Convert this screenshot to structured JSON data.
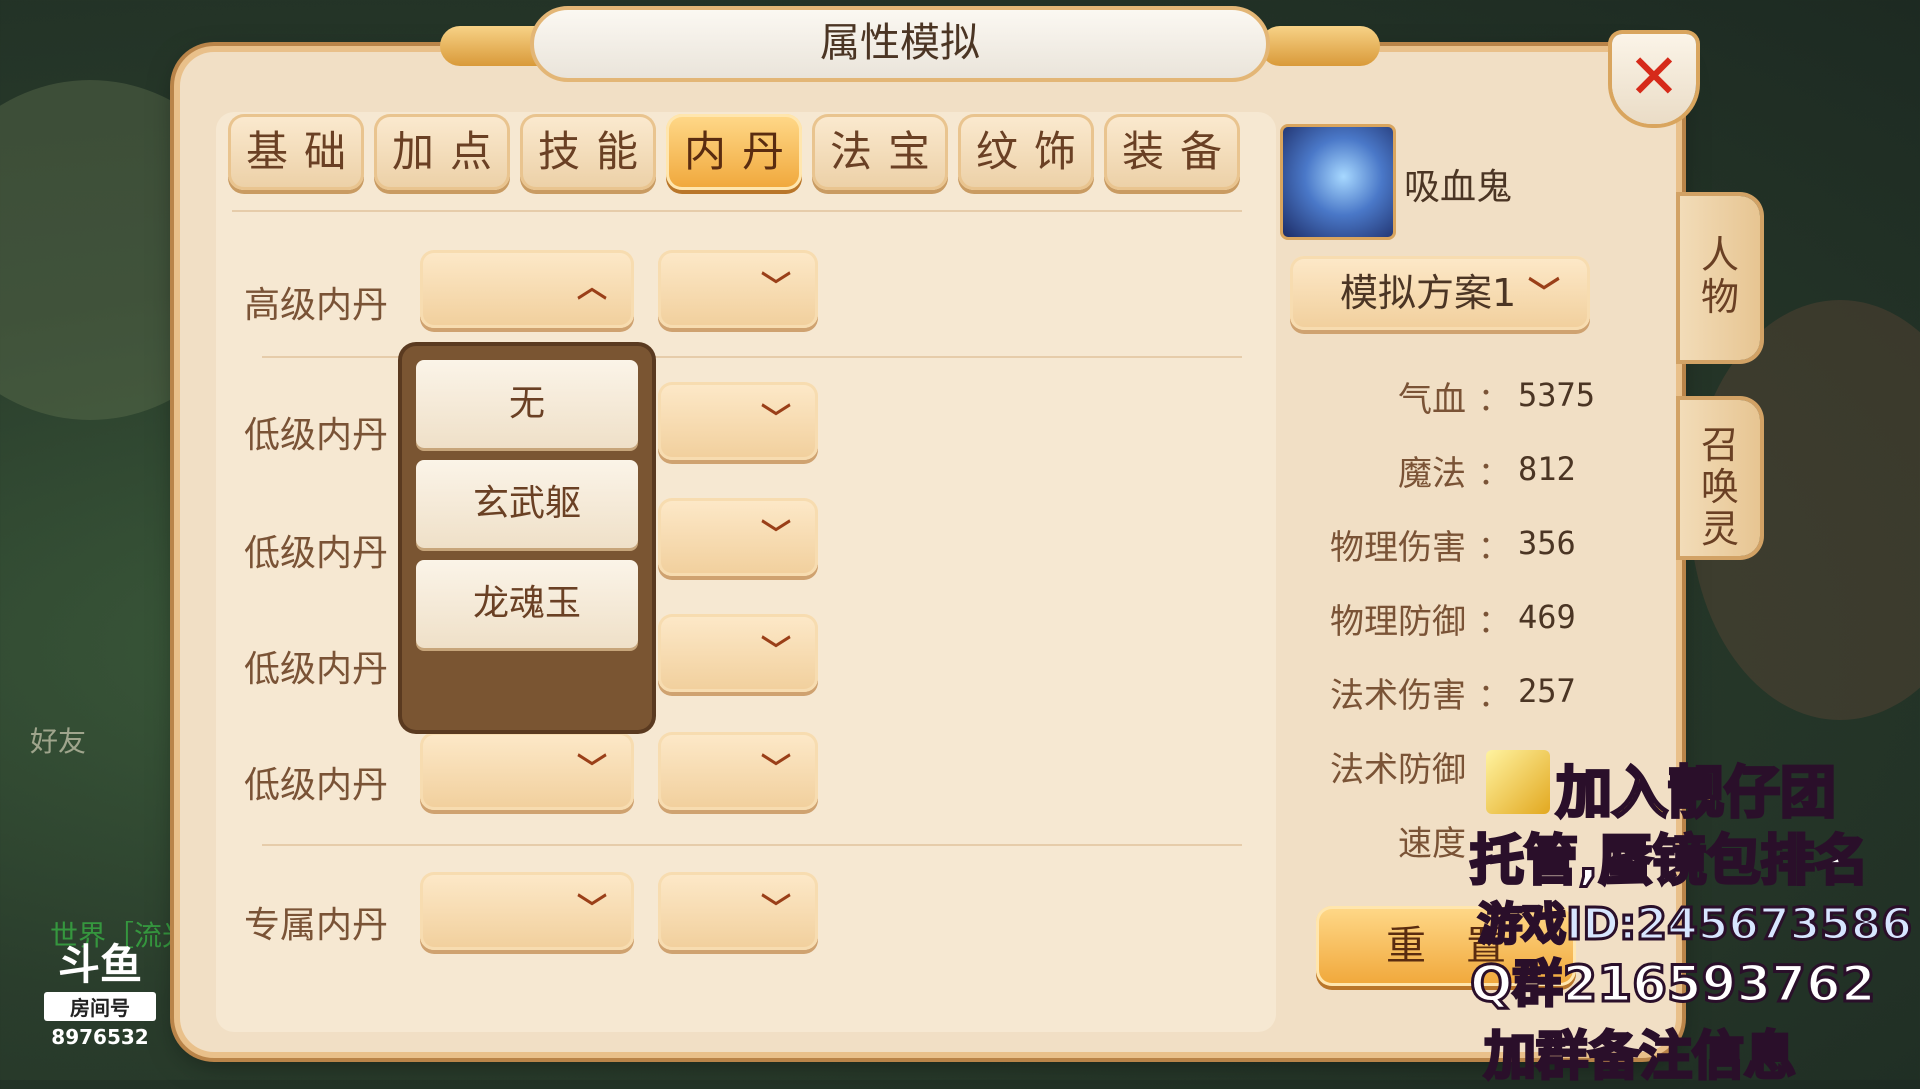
{
  "title": "属性模拟",
  "tabs": [
    {
      "label": "基础"
    },
    {
      "label": "加点"
    },
    {
      "label": "技能"
    },
    {
      "label": "内丹"
    },
    {
      "label": "法宝"
    },
    {
      "label": "纹饰"
    },
    {
      "label": "装备"
    }
  ],
  "rows": [
    {
      "label": "高级内丹"
    },
    {
      "label": "低级内丹"
    },
    {
      "label": "低级内丹"
    },
    {
      "label": "低级内丹"
    },
    {
      "label": "低级内丹"
    },
    {
      "label": "专属内丹"
    }
  ],
  "dropdown": {
    "options": [
      "无",
      "玄武躯",
      "龙魂玉"
    ]
  },
  "pet": {
    "name": "吸血鬼",
    "plan": "模拟方案1"
  },
  "stats": [
    {
      "label": "气血",
      "value": "5375"
    },
    {
      "label": "魔法",
      "value": "812"
    },
    {
      "label": "物理伤害",
      "value": "356"
    },
    {
      "label": "物理防御",
      "value": "469"
    },
    {
      "label": "法术伤害",
      "value": "257"
    },
    {
      "label": "法术防御",
      "value": ""
    },
    {
      "label": "速度",
      "value": ""
    }
  ],
  "stat_colon": "：",
  "reset_label": "重置",
  "side_tabs": {
    "character": "人物",
    "summon": "召唤灵"
  },
  "close_glyph": "✕",
  "background_text": {
    "friends": "好友",
    "world": "世界［流光"
  },
  "overlay": {
    "line1": "加入靓仔团",
    "line2": "托管,蜃镜包排名",
    "line3": "游戏ID:245673586",
    "line4": "Q群216593762",
    "line5": "加群备注信息"
  },
  "douyu": {
    "logo": "斗鱼",
    "room_label": "房间号",
    "room_number": "8976532"
  },
  "colors": {
    "panel": "#f1dfc5",
    "accent_tab": "#f0a73a",
    "text_brown": "#6a4024",
    "close_red": "#d62a1a"
  }
}
